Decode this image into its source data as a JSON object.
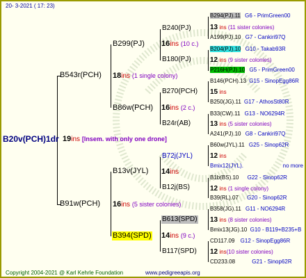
{
  "date": "20-  3-2021 (  17:  23)",
  "root": {
    "name": "B20v(PCH)1dr",
    "count": "19",
    "unit": "ins",
    "note": "[Insem. with only one drone]"
  },
  "father": {
    "name": "B543r(PCH)",
    "count": "18",
    "unit": "ins",
    "note": "(1 single colony)"
  },
  "mother": {
    "name": "B91w(PCH)",
    "count": "16",
    "unit": "ins",
    "note": "(5 sister colonies)"
  },
  "b299": {
    "name": "B299(PJ)",
    "count": "16",
    "unit": "ins",
    "note": "(10 c.)"
  },
  "b86w": {
    "name": "B86w(PCH)",
    "count": "16",
    "unit": "ins",
    "note": "(2 c.)"
  },
  "b13v": {
    "name": "B13v(JYL)",
    "count": "14",
    "unit": "ins"
  },
  "b394": {
    "name": "B394(SPD)",
    "count": "14",
    "unit": "ins",
    "note": "(9 c.)"
  },
  "b240": {
    "name": "B240(PJ)"
  },
  "b180": {
    "name": "B180(PJ)"
  },
  "b270": {
    "name": "B270(PCH)"
  },
  "b24r": {
    "name": "B24r(AB)"
  },
  "b72j": {
    "name": "B72j(JYL)"
  },
  "b12j": {
    "name": "B12j(BS)"
  },
  "b613": {
    "name": "B613(SPD)"
  },
  "b117": {
    "name": "B117(SPD)"
  },
  "g1": {
    "top": "B294(PJ).11",
    "top_tag": "G6 - PrimGreen00",
    "count": "13",
    "unit": "ins",
    "note": "(11 sister colonies)",
    "bottom": "A199(PJ).10",
    "bottom_tag": "G7 - Cankiri97Q"
  },
  "g2": {
    "top": "B204(PJ).10",
    "top_tag": "G10 - Takab93R",
    "count": "12",
    "unit": "ins",
    "note": "(9 sister colonies)",
    "bottom": "P216H(PJ).10",
    "bottom_tag": "G5 - PrimGreen00"
  },
  "g3": {
    "top": "B146(PCH).13",
    "top_tag": "G15 - SinopEgg86R",
    "count": "15",
    "unit": "ins",
    "bottom": "B250(JG).11",
    "bottom_tag": "G17 - AthosSt80R"
  },
  "g4": {
    "top": "B33(CW).11",
    "top_tag": "G13 - NO6294R",
    "count": "13",
    "unit": "ins",
    "note": "(5 sister colonies)",
    "bottom": "A241(PJ).10",
    "bottom_tag": "G8 - Cankiri97Q"
  },
  "g5": {
    "top": "B60w(JYL).11",
    "top_tag": "G25 - Sinop62R",
    "count": "12",
    "unit": "ins",
    "bottom": "Bmix12(JYL).",
    "bottom_tag": "no more"
  },
  "g6": {
    "top": "B1b(BS).10",
    "top_tag": "G22 - Sinop62R",
    "count": "12",
    "unit": "ins",
    "note": "(1 single colony)",
    "bottom": "B39(RL).07",
    "bottom_tag": "G20 - Sinop62R"
  },
  "g7": {
    "top": "B358(JG).11",
    "top_tag": "G11 - NO6294R",
    "count": "13",
    "unit": "ins",
    "note": "(8 sister colonies)",
    "bottom": "Bmix13(JG).10",
    "bottom_tag": "G10 - B119+B235+B"
  },
  "g8": {
    "top": "CD117.09",
    "top_tag": "G12 - SinopEgg86R",
    "count": "12",
    "unit": "ins",
    "note": "(10 sister colonies)",
    "bottom": "CD233.08",
    "bottom_tag": "G21 - Sinop62R"
  },
  "footer": {
    "copyright": "Copyright 2004-2021 @ Karl Kehrle Foundation",
    "url": "www.pedigreeapis.org"
  },
  "colors": {
    "border": "#9a9a00",
    "background": "#fffff0",
    "highlight_yellow": "#ffff00",
    "highlight_gray": "#bdbdbd",
    "highlight_cyan": "#33e0e0",
    "highlight_green": "#00c000"
  }
}
